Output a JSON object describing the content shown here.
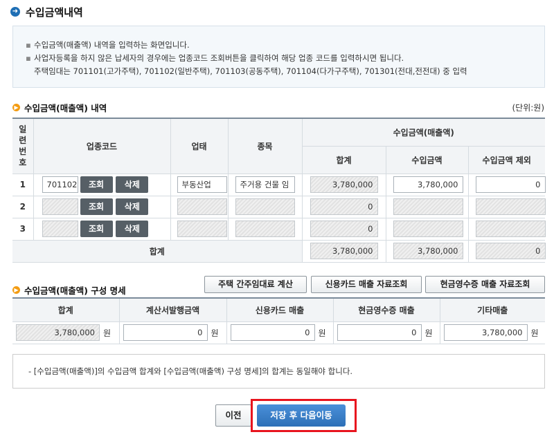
{
  "page_title": "수입금액내역",
  "info": {
    "lines": [
      "수입금액(매출액) 내역을 입력하는 화면입니다.",
      "사업자등록을 하지 않은 납세자의 경우에는 업종코드 조회버튼을 클릭하여 해당 업종 코드를 입력하시면 됩니다."
    ],
    "indent_line": "주택임대는 701101(고가주택), 701102(일반주택), 701103(공동주택), 701104(다가구주택), 701301(전대,전전대) 중 입력"
  },
  "section1": {
    "title": "수입금액(매출액) 내역",
    "unit": "(단위:원)",
    "headers": {
      "row_no": "일련번호",
      "code": "업종코드",
      "biz_type": "업태",
      "item": "종목",
      "revenue_group": "수입금액(매출액)",
      "total": "합계",
      "revenue": "수입금액",
      "excluded": "수입금액 제외"
    },
    "rows": [
      {
        "no": "1",
        "code": "701102",
        "biz_type": "부동산업",
        "item": "주거용 건물 임",
        "total": "3,780,000",
        "revenue": "3,780,000",
        "excluded": "0"
      },
      {
        "no": "2",
        "code": "",
        "biz_type": "",
        "item": "",
        "total": "0",
        "revenue": "",
        "excluded": ""
      },
      {
        "no": "3",
        "code": "",
        "biz_type": "",
        "item": "",
        "total": "0",
        "revenue": "",
        "excluded": ""
      }
    ],
    "lookup_label": "조회",
    "delete_label": "삭제",
    "sum_label": "합계",
    "sum": {
      "total": "3,780,000",
      "revenue": "3,780,000",
      "excluded": "0"
    }
  },
  "section2": {
    "title": "수입금액(매출액) 구성 명세",
    "buttons": [
      "주택 간주임대료 계산",
      "신용카드 매출 자료조회",
      "현금영수증 매출 자료조회"
    ],
    "headers": [
      "합계",
      "계산서발행금액",
      "신용카드 매출",
      "현금영수증 매출",
      "기타매출"
    ],
    "values": [
      "3,780,000",
      "0",
      "0",
      "0",
      "3,780,000"
    ],
    "won": "원"
  },
  "note": "- [수입금액(매출액)]의 수입금액 합계와 [수입금액(매출액) 구성 명세]의 합계는 동일해야 합니다.",
  "footer": {
    "prev": "이전",
    "next": "저장 후 다음이동"
  },
  "colors": {
    "accent_blue": "#2d6fb7",
    "highlight_red": "#e8141e",
    "section_dot": "#f39c12"
  }
}
